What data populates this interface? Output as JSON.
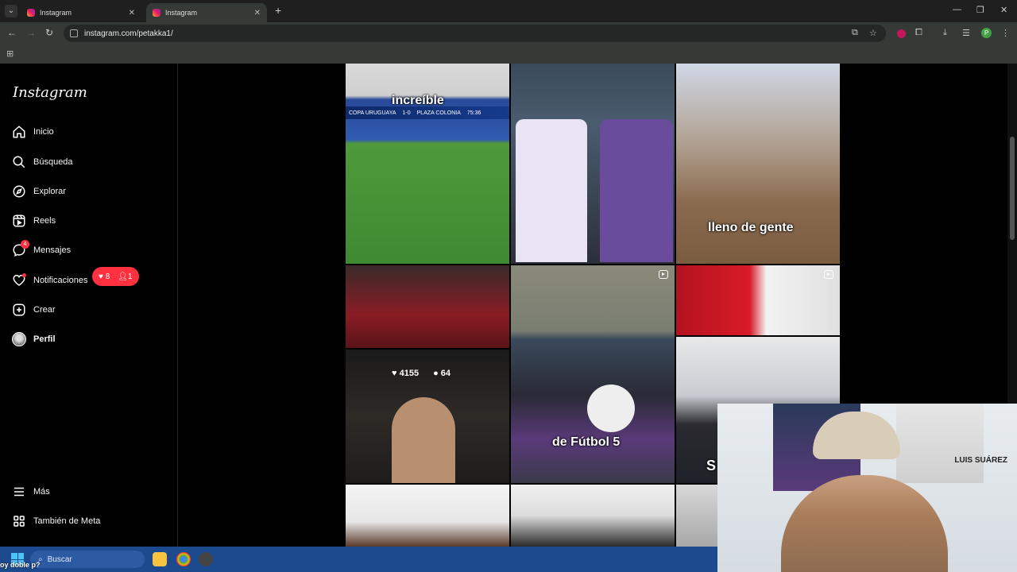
{
  "browser": {
    "tabs": [
      {
        "title": "Instagram",
        "active": false
      },
      {
        "title": "Instagram",
        "active": true
      }
    ],
    "url": "instagram.com/petakka1/",
    "profile_initial": "P",
    "extension_initial": "U"
  },
  "sidebar": {
    "logo": "Instagram",
    "items": [
      {
        "label": "Inicio",
        "icon": "home-icon"
      },
      {
        "label": "Búsqueda",
        "icon": "search-icon"
      },
      {
        "label": "Explorar",
        "icon": "compass-icon"
      },
      {
        "label": "Reels",
        "icon": "reels-icon"
      },
      {
        "label": "Mensajes",
        "icon": "messenger-icon",
        "badge": "4"
      },
      {
        "label": "Notificaciones",
        "icon": "heart-icon"
      },
      {
        "label": "Crear",
        "icon": "plus-square-icon"
      },
      {
        "label": "Perfil",
        "icon": "avatar"
      }
    ],
    "bottom_items": [
      {
        "label": "Más",
        "icon": "menu-icon"
      },
      {
        "label": "También de Meta",
        "icon": "meta-grid-icon"
      }
    ],
    "notification_pill": {
      "likes": "8",
      "follows": "1"
    }
  },
  "grid": {
    "captions": {
      "tile1": "increíble",
      "tile3": "lleno de gente",
      "tile8": "de Fútbol 5",
      "tile9": "S"
    },
    "hover_stats": {
      "likes": "4155",
      "comments": "64"
    },
    "scoreboard": {
      "league": "COPA URUGUAYA",
      "score": "1-0",
      "team": "PLAZA COLONIA",
      "time": "75:36"
    }
  },
  "webcam": {
    "label": "LUIS SUÁREZ"
  },
  "taskbar": {
    "search_placeholder": "Buscar",
    "overlay_caption": "oy doble p?"
  },
  "colors": {
    "accent_red": "#ff3040",
    "taskbar_blue": "#1c4a8f",
    "chrome_bg": "#353a36"
  }
}
